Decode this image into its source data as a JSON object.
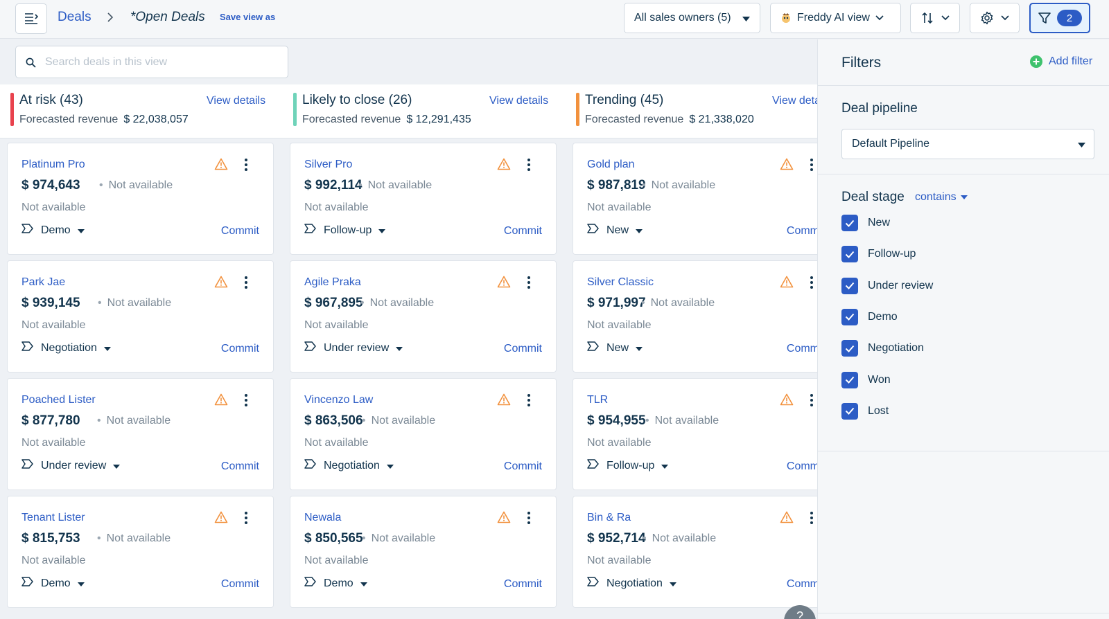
{
  "breadcrumb": {
    "root": "Deals",
    "current_view": "*Open Deals",
    "save_view": "Save view as"
  },
  "toolbar": {
    "owners_label": "All sales owners (5)",
    "freddy_label": "Freddy AI view",
    "filter_count": "2"
  },
  "search": {
    "placeholder": "Search deals in this view",
    "value": ""
  },
  "board": {
    "rev_label": "Forecasted revenue",
    "view_details": "View details",
    "na_text": "Not available",
    "commit_label": "Commit",
    "columns": [
      {
        "title": "At risk (43)",
        "revenue": "$ 22,038,057",
        "color": "#e8424d",
        "cards": [
          {
            "name": "Platinum Pro",
            "amount": "$ 974,643",
            "stage": "Demo"
          },
          {
            "name": "Park Jae",
            "amount": "$ 939,145",
            "stage": "Negotiation"
          },
          {
            "name": "Poached Lister",
            "amount": "$ 877,780",
            "stage": "Under review"
          },
          {
            "name": "Tenant Lister",
            "amount": "$ 815,753",
            "stage": "Demo"
          }
        ]
      },
      {
        "title": "Likely to close (26)",
        "revenue": "$ 12,291,435",
        "color": "#6fd3b9",
        "cards": [
          {
            "name": "Silver Pro",
            "amount": "$ 992,114",
            "stage": "Follow-up"
          },
          {
            "name": "Agile Praka",
            "amount": "$ 967,895",
            "stage": "Under review"
          },
          {
            "name": "Vincenzo Law",
            "amount": "$ 863,506",
            "stage": "Negotiation"
          },
          {
            "name": "Newala",
            "amount": "$ 850,565",
            "stage": "Demo"
          }
        ]
      },
      {
        "title": "Trending (45)",
        "revenue": "$ 21,338,020",
        "color": "#f2913d",
        "cards": [
          {
            "name": "Gold plan",
            "amount": "$ 987,819",
            "stage": "New"
          },
          {
            "name": "Silver Classic",
            "amount": "$ 971,997",
            "stage": "New"
          },
          {
            "name": "TLR",
            "amount": "$ 954,955",
            "stage": "Follow-up"
          },
          {
            "name": "Bin & Ra",
            "amount": "$ 952,714",
            "stage": "Negotiation"
          }
        ]
      }
    ]
  },
  "filters": {
    "title": "Filters",
    "add_filter": "Add filter",
    "pipeline_label": "Deal pipeline",
    "pipeline_value": "Default Pipeline",
    "stage_label": "Deal stage",
    "stage_operator": "contains",
    "stage_options": [
      "New",
      "Follow-up",
      "Under review",
      "Demo",
      "Negotiation",
      "Won",
      "Lost"
    ]
  },
  "help": "?",
  "colors": {
    "accent": "#2c5cc5",
    "warning": "#f2913d",
    "add_green": "#3ec26d"
  }
}
